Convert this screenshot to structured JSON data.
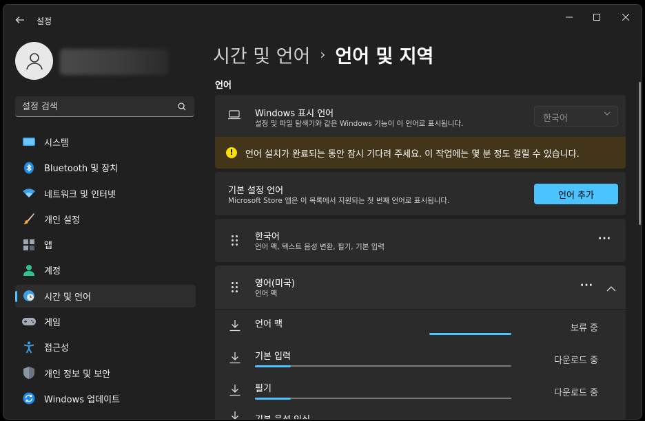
{
  "app": {
    "title": "설정"
  },
  "window_controls": {
    "minimize": "—",
    "maximize": "□",
    "close": "✕"
  },
  "sidebar": {
    "search_placeholder": "설정 검색",
    "items": [
      {
        "label": "시스템",
        "icon": "system-icon",
        "active": false
      },
      {
        "label": "Bluetooth 및 장치",
        "icon": "bluetooth-icon",
        "active": false
      },
      {
        "label": "네트워크 및 인터넷",
        "icon": "wifi-icon",
        "active": false
      },
      {
        "label": "개인 설정",
        "icon": "brush-icon",
        "active": false
      },
      {
        "label": "앱",
        "icon": "apps-icon",
        "active": false
      },
      {
        "label": "계정",
        "icon": "account-icon",
        "active": false
      },
      {
        "label": "시간 및 언어",
        "icon": "time-language-icon",
        "active": true
      },
      {
        "label": "게임",
        "icon": "gamepad-icon",
        "active": false
      },
      {
        "label": "접근성",
        "icon": "accessibility-icon",
        "active": false
      },
      {
        "label": "개인 정보 및 보안",
        "icon": "shield-icon",
        "active": false
      },
      {
        "label": "Windows 업데이트",
        "icon": "update-icon",
        "active": false
      }
    ]
  },
  "breadcrumb": {
    "parent": "시간 및 언어",
    "separator": "›",
    "current": "언어 및 지역"
  },
  "section": {
    "title": "언어"
  },
  "display_language": {
    "title": "Windows 표시 언어",
    "subtitle": "설정 및 파일 탐색기와 같은 Windows 기능이 이 언어로 표시됩니다.",
    "selected": "한국어"
  },
  "warning": {
    "text": "언어 설치가 완료되는 동안 잠시 기다려 주세요. 이 작업에는 몇 분 정도 걸릴 수 있습니다."
  },
  "preferred": {
    "title": "기본 설정 언어",
    "subtitle": "Microsoft Store 앱은 이 목록에서 지원되는 첫 번째 언어로 표시됩니다.",
    "add_button": "언어 추가"
  },
  "languages": [
    {
      "name": "한국어",
      "features": "언어 팩, 텍스트 음성 변환, 필기, 기본 입력",
      "more": "···"
    },
    {
      "name": "영어(미국)",
      "features": "언어 팩",
      "more": "···",
      "expand": "︿"
    }
  ],
  "downloads": [
    {
      "label": "언어 팩",
      "status": "보류 중",
      "progress": 0.32,
      "progress_start": 0.68
    },
    {
      "label": "기본 입력",
      "status": "다운로드 중",
      "progress": 0.14,
      "progress_start": 0
    },
    {
      "label": "필기",
      "status": "다운로드 중",
      "progress": 0.14,
      "progress_start": 0
    },
    {
      "label": "기본 음성 인식",
      "status": "",
      "progress": 0,
      "progress_start": 0
    }
  ],
  "colors": {
    "accent": "#4cc2ff",
    "warning_bg": "#433519",
    "warning_icon": "#fce100"
  }
}
